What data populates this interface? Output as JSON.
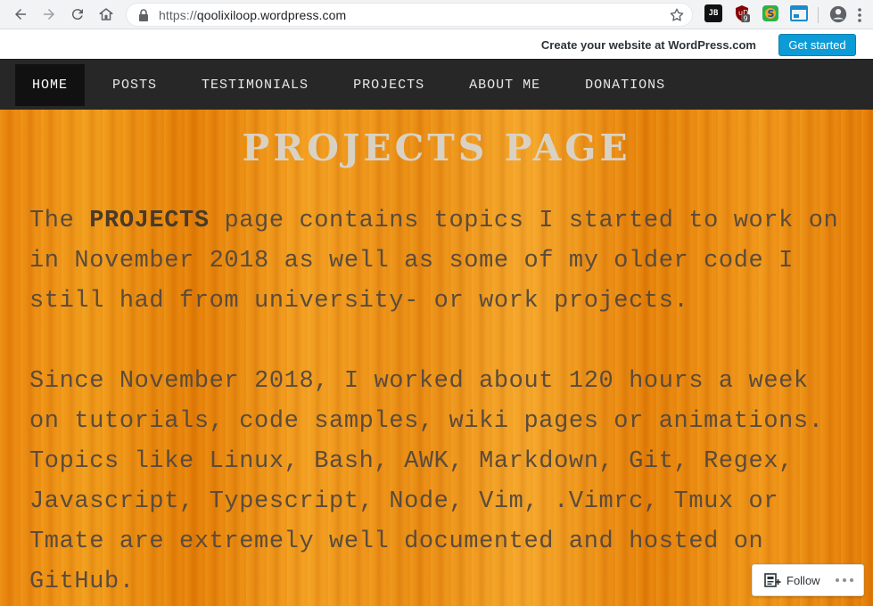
{
  "browser": {
    "url_scheme": "https://",
    "url_host": "qoolixiloop.wordpress.com",
    "extensions": [
      "jetbrains-icon",
      "ublock-icon",
      "s-extension-icon",
      "window-extension-icon"
    ],
    "badge_count": "9",
    "ext_jb_text": "JB"
  },
  "wp_banner": {
    "text": "Create your website at WordPress.com",
    "button_label": "Get started",
    "accent": "#0d9bd7"
  },
  "nav": {
    "items": [
      {
        "label": "HOME",
        "active": true
      },
      {
        "label": "POSTS"
      },
      {
        "label": "TESTIMONIALS"
      },
      {
        "label": "PROJECTS"
      },
      {
        "label": "ABOUT ME"
      },
      {
        "label": "DONATIONS"
      }
    ]
  },
  "page": {
    "title": "PROJECTS PAGE",
    "para1_prefix": "The ",
    "para1_bold": "PROJECTS",
    "para1_rest": " page contains topics I started to work on in November 2018 as well as some of my older code I still had from university- or work projects.",
    "para2": "Since November 2018, I worked about 120 hours a week on tutorials, code samples, wiki pages or animations. Topics like Linux, Bash, AWK, Markdown, Git, Regex, Javascript, Typescript, Node, Vim, .Vimrc, Tmux or Tmate are extremely well documented and hosted on GitHub."
  },
  "follow": {
    "label": "Follow"
  }
}
